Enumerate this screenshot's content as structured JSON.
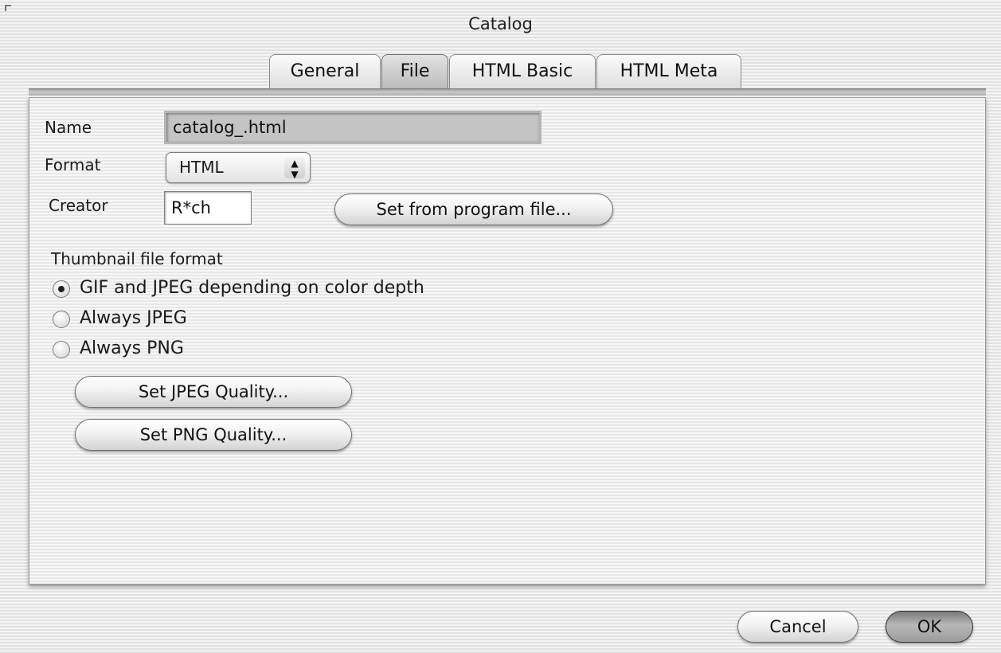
{
  "window": {
    "title": "Catalog"
  },
  "tabs": [
    {
      "label": "General",
      "active": false
    },
    {
      "label": "File",
      "active": true
    },
    {
      "label": "HTML Basic",
      "active": false
    },
    {
      "label": "HTML Meta",
      "active": false
    }
  ],
  "file": {
    "name_label": "Name",
    "name_value": "catalog_.html",
    "format_label": "Format",
    "format_value": "HTML",
    "creator_label": "Creator",
    "creator_value": "R*ch",
    "set_from_program_label": "Set from program file..."
  },
  "thumbnail": {
    "heading": "Thumbnail file format",
    "options": [
      {
        "label": "GIF and JPEG depending on color depth",
        "selected": true
      },
      {
        "label": "Always JPEG",
        "selected": false
      },
      {
        "label": "Always PNG",
        "selected": false
      }
    ],
    "jpeg_quality_label": "Set JPEG Quality...",
    "png_quality_label": "Set PNG Quality..."
  },
  "footer": {
    "cancel_label": "Cancel",
    "ok_label": "OK"
  },
  "icons": {
    "popup_arrows": "up-down-arrows-icon",
    "radio_selected": "radio-selected-icon",
    "radio_unselected": "radio-unselected-icon"
  }
}
